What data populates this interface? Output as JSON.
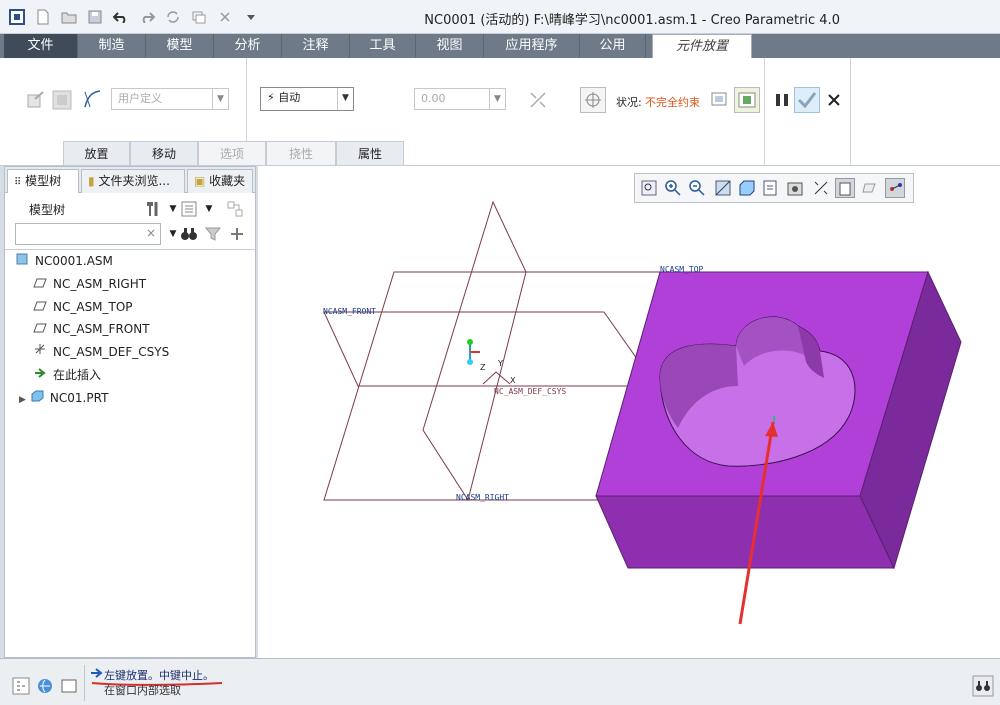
{
  "window": {
    "title": "NC0001 (活动的) F:\\晴峰学习\\nc0001.asm.1 - Creo Parametric 4.0"
  },
  "menu": {
    "file": "文件",
    "tabs": [
      "制造",
      "模型",
      "分析",
      "注释",
      "工具",
      "视图",
      "应用程序",
      "公用"
    ],
    "active": "元件放置"
  },
  "ribbon": {
    "constraint_type": "用户定义",
    "auto_label": "自动",
    "offset_value": "0.00",
    "status_label": "状况:",
    "status_value": "不完全约束",
    "status_color": "#e0551a"
  },
  "subtabs": {
    "place": "放置",
    "move": "移动",
    "options": "选项",
    "flex": "挠性",
    "props": "属性"
  },
  "left_panel": {
    "tabs": [
      "模型树",
      "文件夹浏览...",
      "收藏夹"
    ],
    "title": "模型树",
    "search_placeholder": "",
    "tree": [
      {
        "label": "NC0001.ASM",
        "icon": "assembly-icon"
      },
      {
        "label": "NC_ASM_RIGHT",
        "icon": "datum-plane-icon"
      },
      {
        "label": "NC_ASM_TOP",
        "icon": "datum-plane-icon"
      },
      {
        "label": "NC_ASM_FRONT",
        "icon": "datum-plane-icon"
      },
      {
        "label": "NC_ASM_DEF_CSYS",
        "icon": "csys-icon"
      },
      {
        "label": "在此插入",
        "icon": "insert-arrow-icon"
      },
      {
        "label": "NC01.PRT",
        "icon": "part-icon"
      }
    ]
  },
  "viewport": {
    "labels": {
      "front": "NCASM_FRONT",
      "top": "NCASM_TOP",
      "right": "NCASM_RIGHT",
      "csys": "NC_ASM_DEF_CSYS",
      "axis_x": "X",
      "axis_y": "Y",
      "axis_z": "Z"
    },
    "part_color": "#b040d8"
  },
  "status": {
    "message": "左键放置。中键中止。",
    "hint": "在窗口内部选取"
  }
}
